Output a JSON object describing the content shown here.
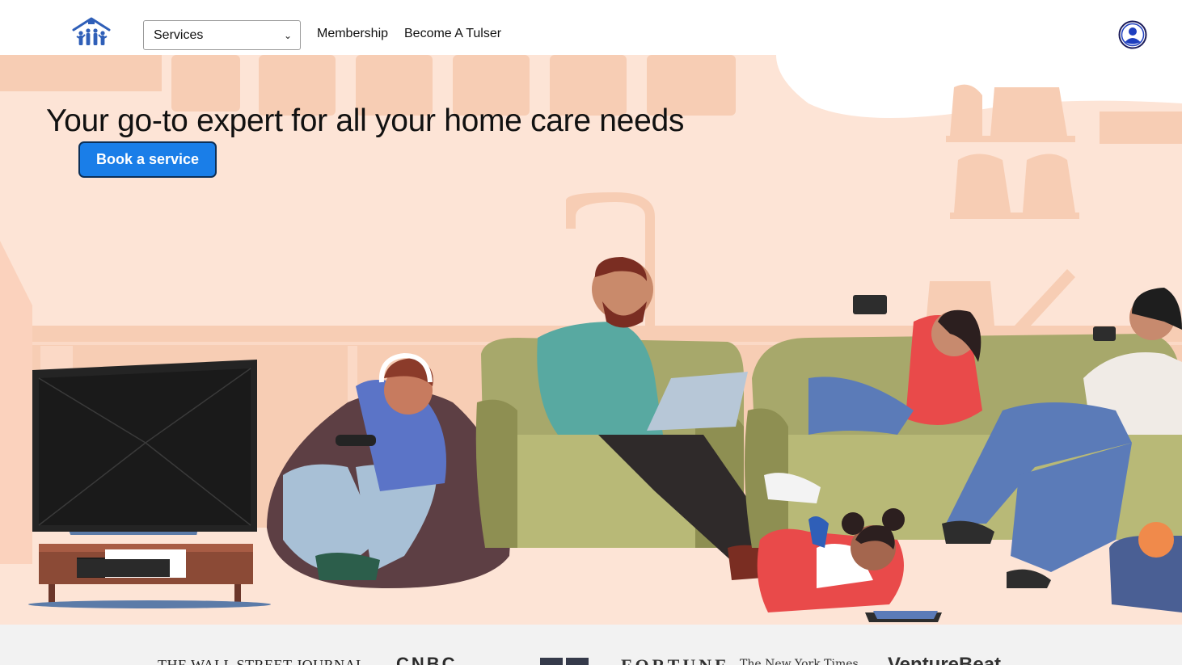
{
  "header": {
    "logo_icon": "house-with-people-logo",
    "services_select": {
      "value": "Services",
      "options": [
        "Services"
      ]
    },
    "nav": {
      "membership": "Membership",
      "become_tulser": "Become A Tulser"
    },
    "profile_icon": "user-circle-icon"
  },
  "hero": {
    "title": "Your go-to expert for all your home care needs",
    "cta": "Book a service",
    "illustration": "family-relaxing-living-room-illustration"
  },
  "press": {
    "logos": [
      "THE WALL STREET JOURNAL",
      "CNBC",
      "",
      "FORTUNE",
      "The New York Times",
      "VentureBeat"
    ]
  },
  "colors": {
    "hero_bg": "#fde4d6",
    "cta_bg": "#1a7ee8",
    "cta_border": "#0c2f57",
    "press_bg": "#f2f2f2",
    "logo_blue": "#2f5fb8"
  }
}
